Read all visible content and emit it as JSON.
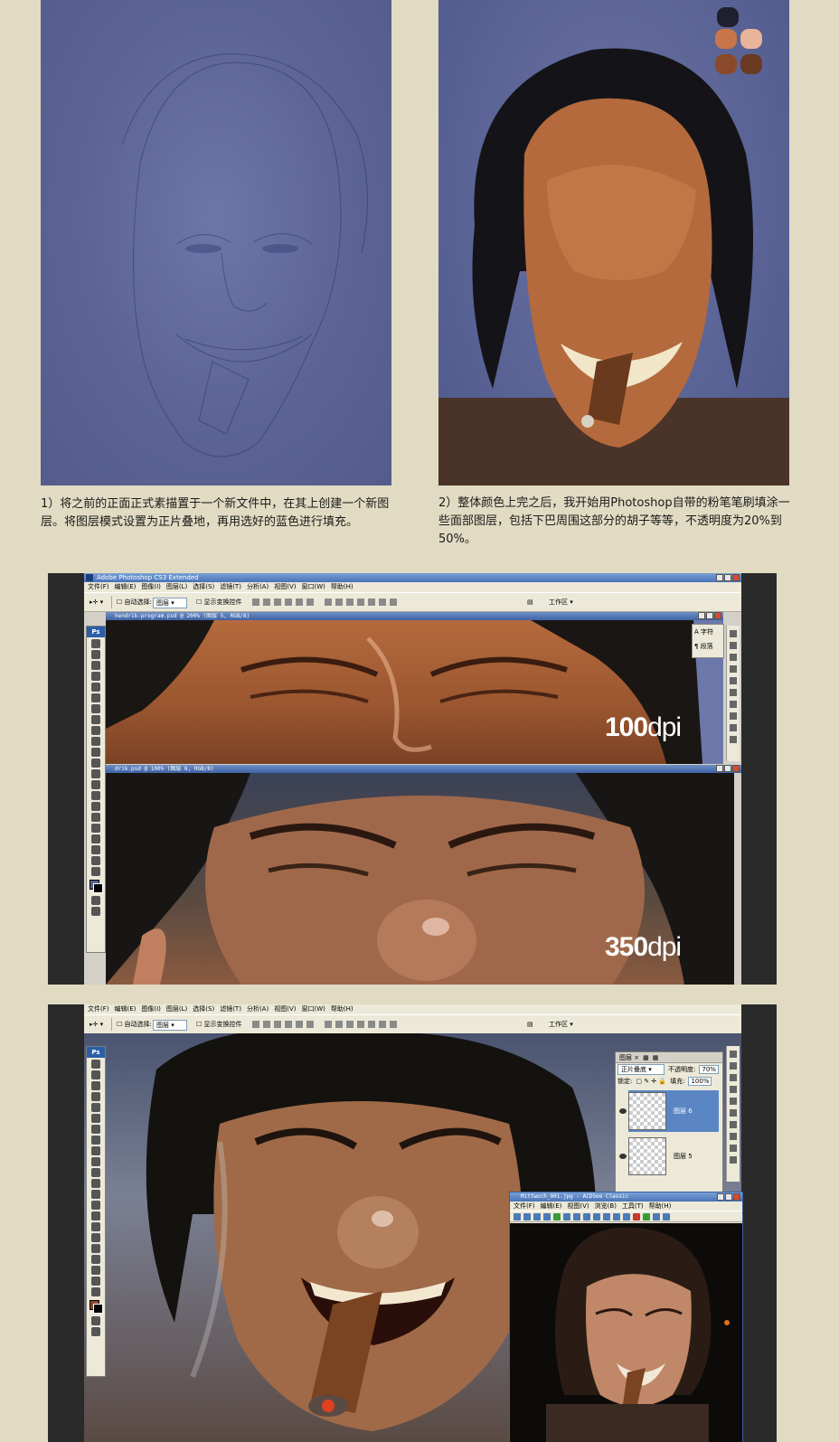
{
  "captions": {
    "step1": "1）将之前的正面正式素描置于一个新文件中，在其上创建一个新图层。将图层模式设置为正片叠地，再用选好的蓝色进行填充。",
    "step2": "2）整体颜色上完之后，我开始用Photoshop自带的粉笔笔刷填涂一些面部图层，包括下巴周围这部分的胡子等等，不透明度为20%到50%。"
  },
  "palette_swatches": [
    "#1e2030",
    "#c8754a",
    "#e8b49a",
    "#8a4a2a",
    "#6a3a22"
  ],
  "ps_window_1": {
    "app_title": "Adobe Photoshop CS3 Extended",
    "menu": [
      "文件(F)",
      "编辑(E)",
      "图像(I)",
      "图层(L)",
      "选择(S)",
      "滤镜(T)",
      "分析(A)",
      "视图(V)",
      "窗口(W)",
      "帮助(H)"
    ],
    "options": {
      "auto_select_label": "自动选择:",
      "auto_select_value": "图层",
      "show_transform_label": "显示变换控件",
      "workspace_label": "工作区 ▾"
    },
    "doc1_title": "hendrik-program.psd @ 200% (图层 5, RGB/8)",
    "doc2_title": "drik.psd @ 100% (图层 6, RGB/8)",
    "label_100": {
      "num": "100",
      "unit": "dpi"
    },
    "label_350": {
      "num": "350",
      "unit": "dpi"
    },
    "char_panel": [
      "字符",
      "段落"
    ]
  },
  "ps_window_2": {
    "menu": [
      "文件(F)",
      "编辑(E)",
      "图像(I)",
      "图层(L)",
      "选择(S)",
      "滤镜(T)",
      "分析(A)",
      "视图(V)",
      "窗口(W)",
      "帮助(H)"
    ],
    "options": {
      "auto_select_label": "自动选择:",
      "auto_select_value": "图层",
      "show_transform_label": "显示变换控件",
      "workspace_label": "工作区 ▾"
    },
    "layers_panel": {
      "tab": "图层 ×",
      "blend_mode": "正片叠底",
      "opacity_label": "不透明度:",
      "opacity_value": "70%",
      "lock_label": "锁定:",
      "fill_label": "填充:",
      "fill_value": "100%",
      "layers": [
        "图层 6",
        "图层 5"
      ]
    },
    "acdsee": {
      "title": "Mittwoch_001.jpg - ACDSee Classic",
      "menu": [
        "文件(F)",
        "编辑(E)",
        "视图(V)",
        "浏览(B)",
        "工具(T)",
        "帮助(H)"
      ]
    }
  }
}
